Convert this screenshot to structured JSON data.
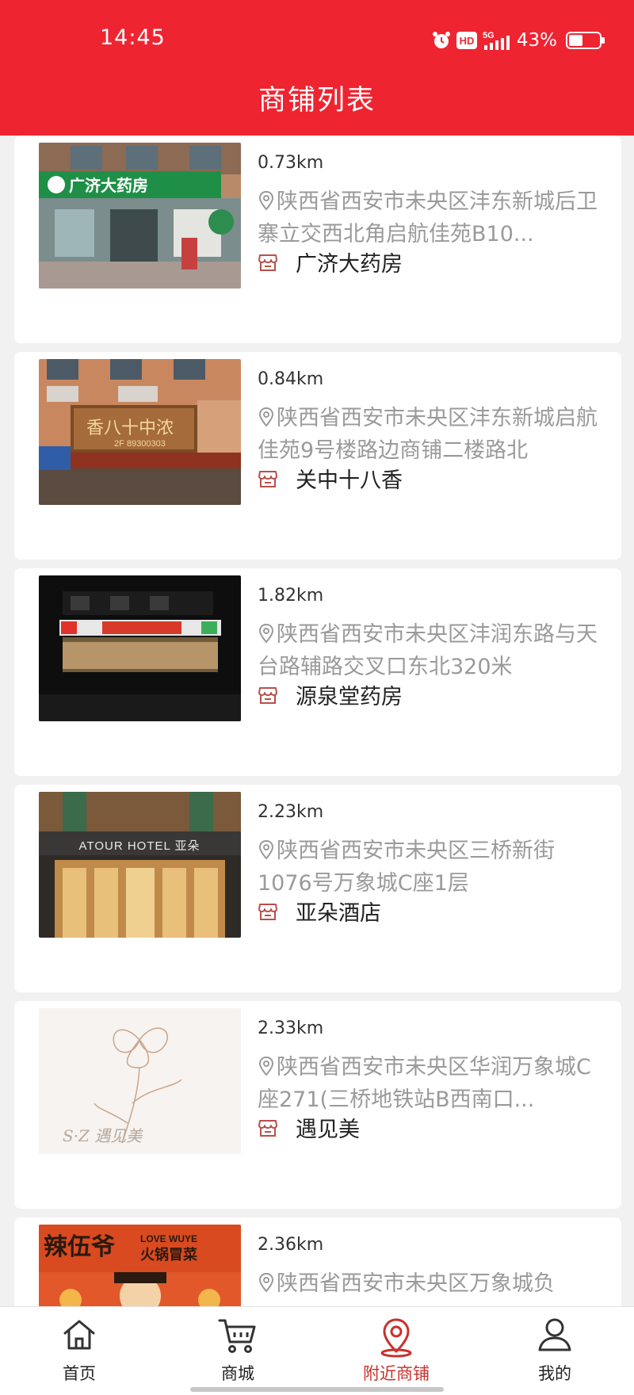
{
  "status_bar": {
    "time": "14:45",
    "battery": "43%",
    "network": "5G",
    "hd": "HD"
  },
  "header": {
    "title": "商铺列表"
  },
  "stores": [
    {
      "distance": "0.73km",
      "address": "陕西省西安市未央区沣东新城后卫寨立交西北角启航佳苑B10...",
      "name": "广济大药房"
    },
    {
      "distance": "0.84km",
      "address": "陕西省西安市未央区沣东新城启航佳苑9号楼路边商铺二楼路北",
      "name": "关中十八香"
    },
    {
      "distance": "1.82km",
      "address": "陕西省西安市未央区沣润东路与天台路辅路交叉口东北320米",
      "name": "源泉堂药房"
    },
    {
      "distance": "2.23km",
      "address": "陕西省西安市未央区三桥新街1076号万象城C座1层",
      "name": "亚朵酒店"
    },
    {
      "distance": "2.33km",
      "address": "陕西省西安市未央区华润万象城C座271(三桥地铁站B西南口...",
      "name": "遇见美"
    },
    {
      "distance": "2.36km",
      "address": "陕西省西安市未央区万象城负",
      "name": ""
    }
  ],
  "image_text": {
    "pharmacy_sign": "广济大药房",
    "restaurant_sign": "香八十中浓",
    "restaurant_phone": "2F 89300303",
    "hotel_sign": "ATOUR HOTEL 亚朵",
    "beauty_logo": "S·Z 遇见美",
    "hotpot_sign": "辣伍爷",
    "hotpot_sub": "火锅冒菜",
    "hotpot_en": "LOVE WUYE"
  },
  "tabbar": {
    "items": [
      {
        "label": "首页",
        "icon": "home-icon"
      },
      {
        "label": "商城",
        "icon": "cart-icon"
      },
      {
        "label": "附近商铺",
        "icon": "location-icon",
        "active": true
      },
      {
        "label": "我的",
        "icon": "user-icon"
      }
    ]
  },
  "colors": {
    "brand": "#ef2431",
    "active_tab": "#c9302c",
    "address": "#9a9a9a",
    "shop_icon": "#b8504a"
  }
}
